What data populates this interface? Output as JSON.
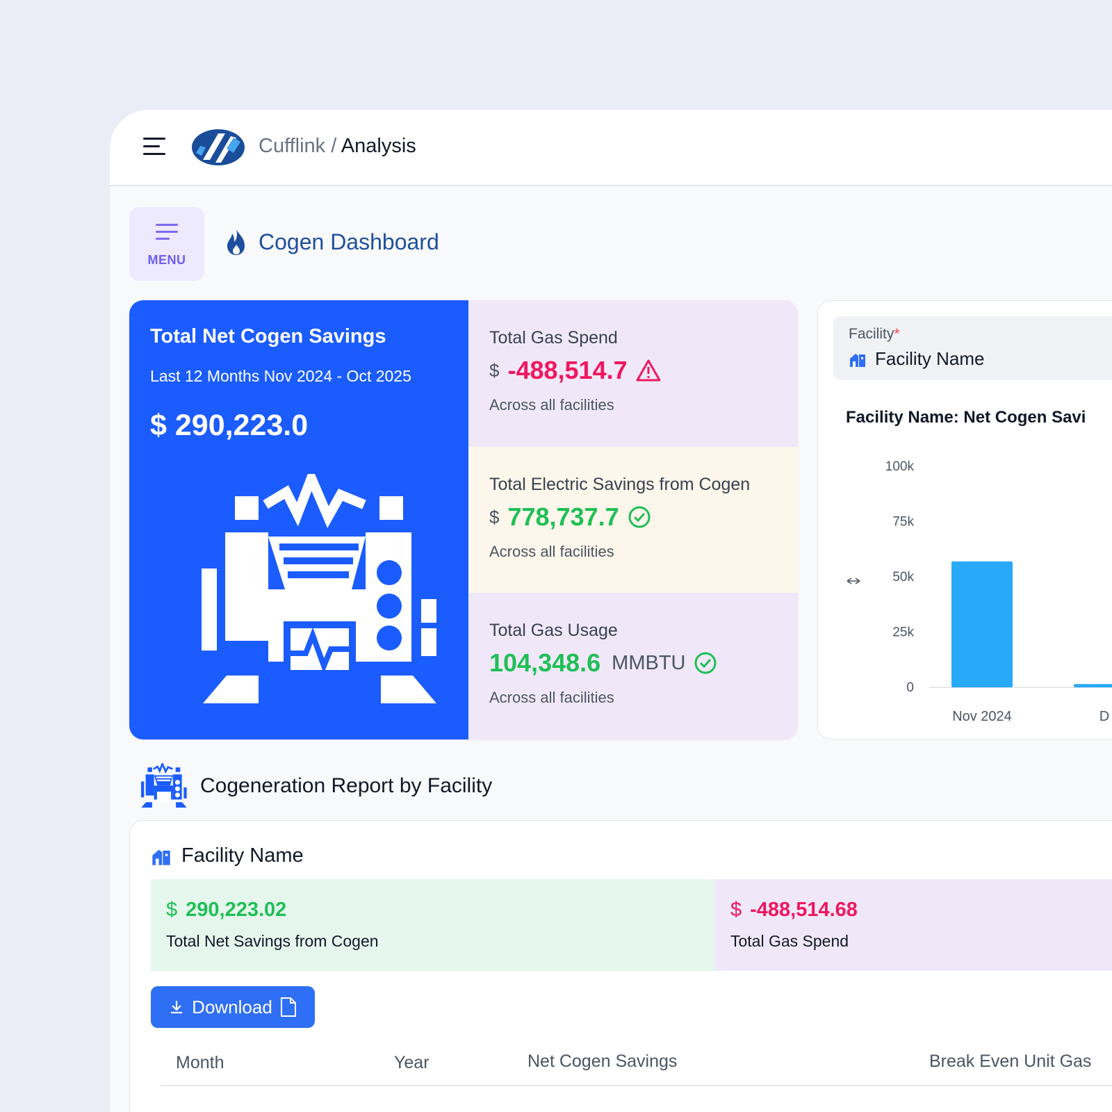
{
  "header": {
    "brand": "Cufflink",
    "separator": "/",
    "page": "Analysis",
    "icons": [
      "hamburger-icon",
      "cufflink-logo"
    ]
  },
  "menu_button": {
    "label": "MENU",
    "icon": "menu-lines-icon"
  },
  "dashboard": {
    "title": "Cogen Dashboard",
    "icon": "flame-icon"
  },
  "hero": {
    "title": "Total Net Cogen Savings",
    "subtitle": "Last 12 Months Nov 2024 - Oct 2025",
    "value": "$ 290,223.0",
    "icon": "cogeneration-plant-icon",
    "color": "#1b5cff"
  },
  "kpis": [
    {
      "title": "Total Gas Spend",
      "currency": "$",
      "value": "-488,514.7",
      "unit": "",
      "note": "Across all facilities",
      "status": "warning-icon",
      "bg": "#f0e8f8",
      "value_color": "#f0175f"
    },
    {
      "title": "Total Electric Savings from Cogen",
      "currency": "$",
      "value": "778,737.7",
      "unit": "",
      "note": "Across all facilities",
      "status": "check-circle-icon",
      "bg": "#fdf6ea",
      "value_color": "#1fbf56"
    },
    {
      "title": "Total Gas Usage",
      "currency": "",
      "value": "104,348.6",
      "unit": "MMBTU",
      "note": "Across all facilities",
      "status": "check-circle-icon",
      "bg": "#f0e8f8",
      "value_color": "#1fbf56"
    }
  ],
  "facility_select": {
    "label": "Facility",
    "required_mark": "*",
    "value": "Facility Name",
    "icon": "building-icon"
  },
  "chart_title": "Facility Name: Net Cogen Savi",
  "chart_data": {
    "type": "bar",
    "title": "Facility Name: Net Cogen Savi",
    "categories": [
      "Nov 2024",
      "D"
    ],
    "values": [
      57000,
      1500
    ],
    "ylim": [
      0,
      100000
    ],
    "yticks": [
      "100k",
      "75k",
      "50k",
      "25k",
      "0"
    ],
    "ytick_values": [
      100000,
      75000,
      50000,
      25000,
      0
    ],
    "color": "#29aaf9",
    "grid": false
  },
  "report": {
    "title": "Cogeneration Report by Facility",
    "icon": "cogeneration-plant-icon",
    "facility": "Facility Name",
    "tiles": [
      {
        "currency": "$",
        "value": "290,223.02",
        "label": "Total Net Savings from Cogen",
        "bg": "#e5f6ec",
        "value_color": "#1fbf56"
      },
      {
        "currency": "$",
        "value": "-488,514.68",
        "label": "Total Gas Spend",
        "bg": "#f0e8f8",
        "value_color": "#f0175f"
      }
    ],
    "download_label": "Download",
    "download_icons": [
      "download-icon",
      "csv-file-icon"
    ],
    "columns": [
      "Month",
      "Year",
      "Net Cogen Savings",
      "Break Even Unit Gas"
    ]
  }
}
